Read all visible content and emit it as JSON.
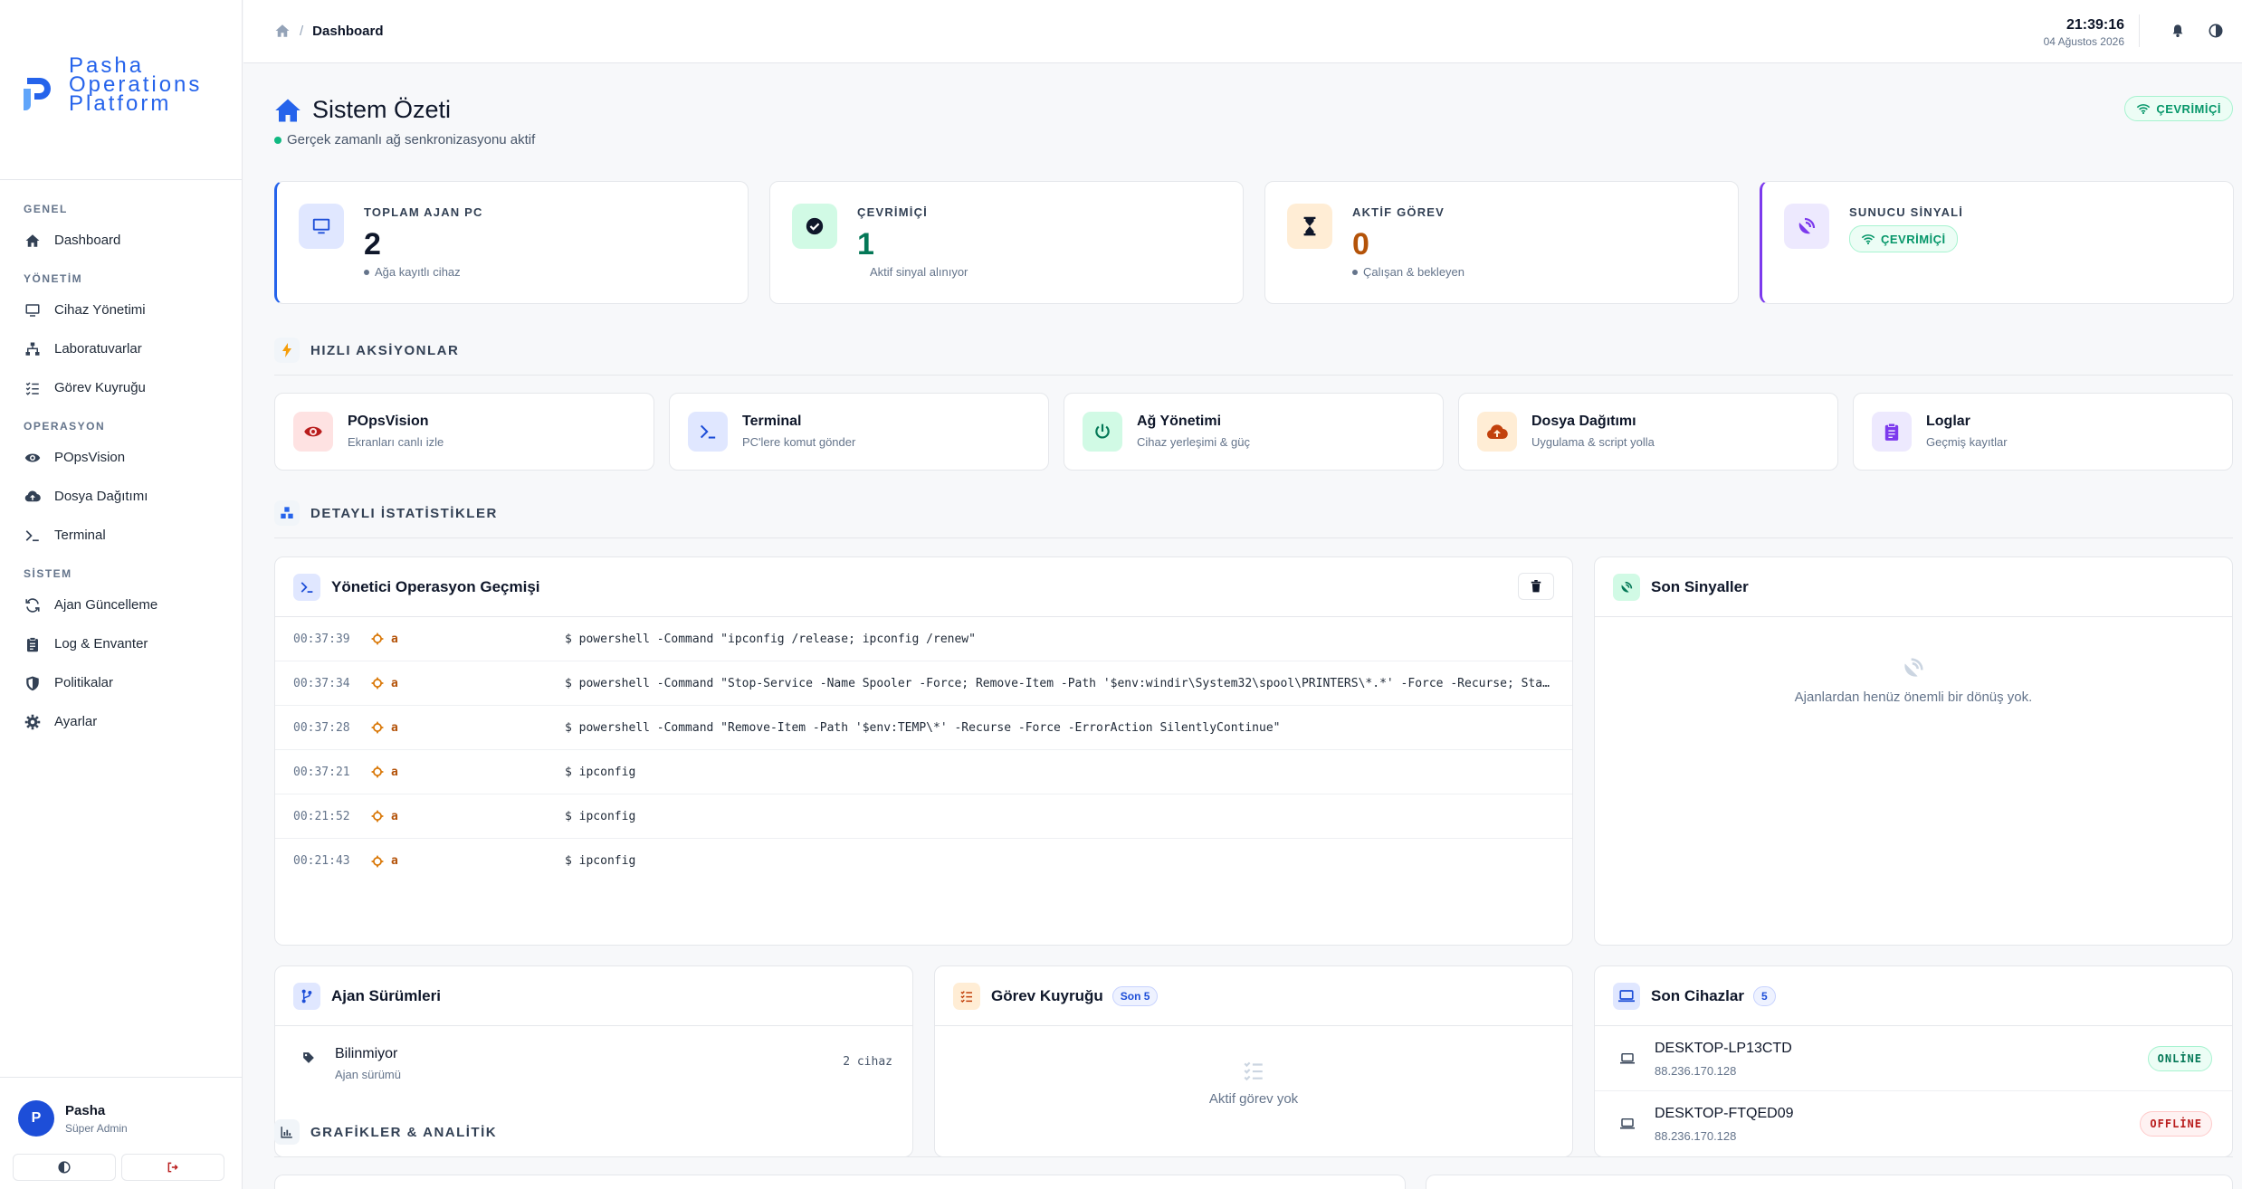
{
  "app": {
    "logo_lines": [
      "Pasha",
      "Operations",
      "Platform"
    ]
  },
  "sidebar": {
    "groups": [
      {
        "title": "GENEL",
        "items": [
          {
            "label": "Dashboard",
            "icon": "home-icon"
          }
        ]
      },
      {
        "title": "YÖNETİM",
        "items": [
          {
            "label": "Cihaz Yönetimi",
            "icon": "monitor-icon"
          },
          {
            "label": "Laboratuvarlar",
            "icon": "sitemap-icon"
          },
          {
            "label": "Görev Kuyruğu",
            "icon": "list-check-icon"
          }
        ]
      },
      {
        "title": "OPERASYON",
        "items": [
          {
            "label": "POpsVision",
            "icon": "eye-icon"
          },
          {
            "label": "Dosya Dağıtımı",
            "icon": "cloud-upload-icon"
          },
          {
            "label": "Terminal",
            "icon": "terminal-icon"
          }
        ]
      },
      {
        "title": "SİSTEM",
        "items": [
          {
            "label": "Ajan Güncelleme",
            "icon": "refresh-icon"
          },
          {
            "label": "Log & Envanter",
            "icon": "clipboard-icon"
          },
          {
            "label": "Politikalar",
            "icon": "shield-icon"
          },
          {
            "label": "Ayarlar",
            "icon": "gear-icon"
          }
        ]
      }
    ],
    "user": {
      "initial": "P",
      "name": "Pasha",
      "role": "Süper Admin"
    }
  },
  "topbar": {
    "breadcrumb_current": "Dashboard",
    "time": "21:39:16",
    "date": "04 Ağustos 2026"
  },
  "page": {
    "title": "Sistem Özeti",
    "subtitle": "Gerçek zamanlı ağ senkronizasyonu aktif",
    "status_pill": "ÇEVRİMİÇİ"
  },
  "stats": [
    {
      "label": "TOPLAM AJAN PC",
      "value": "2",
      "note": "Ağa kayıtlı cihaz",
      "color": "#0f172a"
    },
    {
      "label": "ÇEVRİMİÇİ",
      "value": "1",
      "note": "Aktif sinyal alınıyor",
      "color": "#047857"
    },
    {
      "label": "AKTİF GÖREV",
      "value": "0",
      "note": "Çalışan & bekleyen",
      "color": "#b45309"
    },
    {
      "label": "SUNUCU SİNYALİ",
      "value": "ÇEVRİMİÇİ"
    }
  ],
  "sections": {
    "quick": "HIZLI AKSİYONLAR",
    "detail": "DETAYLI İSTATİSTİKLER",
    "charts": "GRAFİKLER & ANALİTİK"
  },
  "quick_actions": [
    {
      "title": "POpsVision",
      "sub": "Ekranları canlı izle",
      "icon": "eye-icon",
      "bg": "#fee2e2",
      "fg": "#b91c1c"
    },
    {
      "title": "Terminal",
      "sub": "PC'lere komut gönder",
      "icon": "terminal-icon",
      "bg": "#e0e7ff",
      "fg": "#1d4ed8"
    },
    {
      "title": "Ağ Yönetimi",
      "sub": "Cihaz yerleşimi & güç",
      "icon": "power-icon",
      "bg": "#d1fae5",
      "fg": "#047857"
    },
    {
      "title": "Dosya Dağıtımı",
      "sub": "Uygulama & script yolla",
      "icon": "cloud-upload-icon",
      "bg": "#ffedd5",
      "fg": "#c2410c"
    },
    {
      "title": "Loglar",
      "sub": "Geçmiş kayıtlar",
      "icon": "clipboard-icon",
      "bg": "#ede9fe",
      "fg": "#7c3aed"
    }
  ],
  "ops_history": {
    "title": "Yönetici Operasyon Geçmişi",
    "rows": [
      {
        "time": "00:37:39",
        "user": "a",
        "cmd": "$ powershell -Command \"ipconfig /release; ipconfig /renew\""
      },
      {
        "time": "00:37:34",
        "user": "a",
        "cmd": "$ powershell -Command \"Stop-Service -Name Spooler -Force; Remove-Item -Path '$env:windir\\System32\\spool\\PRINTERS\\*.*' -Force -Recurse; Start-Service -Name Spooler\""
      },
      {
        "time": "00:37:28",
        "user": "a",
        "cmd": "$ powershell -Command \"Remove-Item -Path '$env:TEMP\\*' -Recurse -Force -ErrorAction SilentlyContinue\""
      },
      {
        "time": "00:37:21",
        "user": "a",
        "cmd": "$ ipconfig"
      },
      {
        "time": "00:21:52",
        "user": "a",
        "cmd": "$ ipconfig"
      },
      {
        "time": "00:21:43",
        "user": "a",
        "cmd": "$ ipconfig"
      }
    ]
  },
  "signals": {
    "title": "Son Sinyaller",
    "empty": "Ajanlardan henüz önemli bir dönüş yok."
  },
  "versions": {
    "title": "Ajan Sürümleri",
    "rows": [
      {
        "name": "Bilinmiyor",
        "sub": "Ajan sürümü",
        "count": "2 cihaz"
      }
    ]
  },
  "queue": {
    "title": "Görev Kuyruğu",
    "badge": "Son 5",
    "empty": "Aktif görev yok"
  },
  "devices": {
    "title": "Son Cihazlar",
    "badge": "5",
    "rows": [
      {
        "name": "DESKTOP-LP13CTD",
        "ip": "88.236.170.128",
        "status": "ONLİNE"
      },
      {
        "name": "DESKTOP-FTQED09",
        "ip": "88.236.170.128",
        "status": "OFFLİNE"
      }
    ]
  }
}
